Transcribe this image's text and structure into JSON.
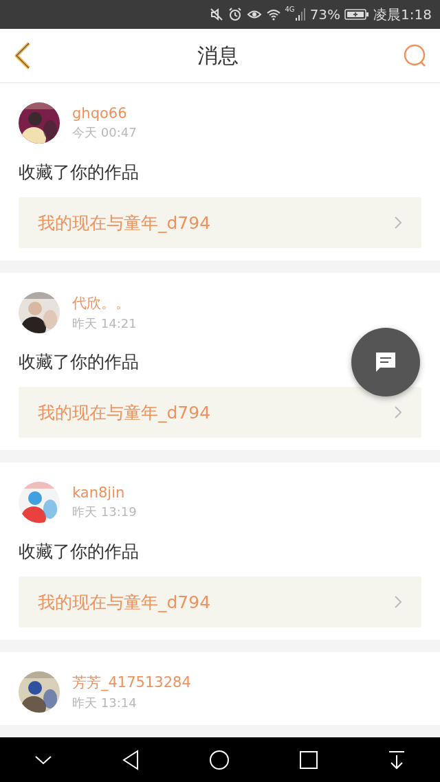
{
  "status_bar": {
    "network": "4G",
    "battery": "73%",
    "time": "凌晨1:18"
  },
  "header": {
    "title": "消息"
  },
  "messages": [
    {
      "user": "ghqo66",
      "time": "今天 00:47",
      "action": "收藏了你的作品",
      "work": "我的现在与童年_d794"
    },
    {
      "user": "代欣。。",
      "time": "昨天 14:21",
      "action": "收藏了你的作品",
      "work": "我的现在与童年_d794"
    },
    {
      "user": "kan8jin",
      "time": "昨天 13:19",
      "action": "收藏了你的作品",
      "work": "我的现在与童年_d794"
    },
    {
      "user": "芳芳_417513284",
      "time": "昨天 13:14"
    }
  ]
}
